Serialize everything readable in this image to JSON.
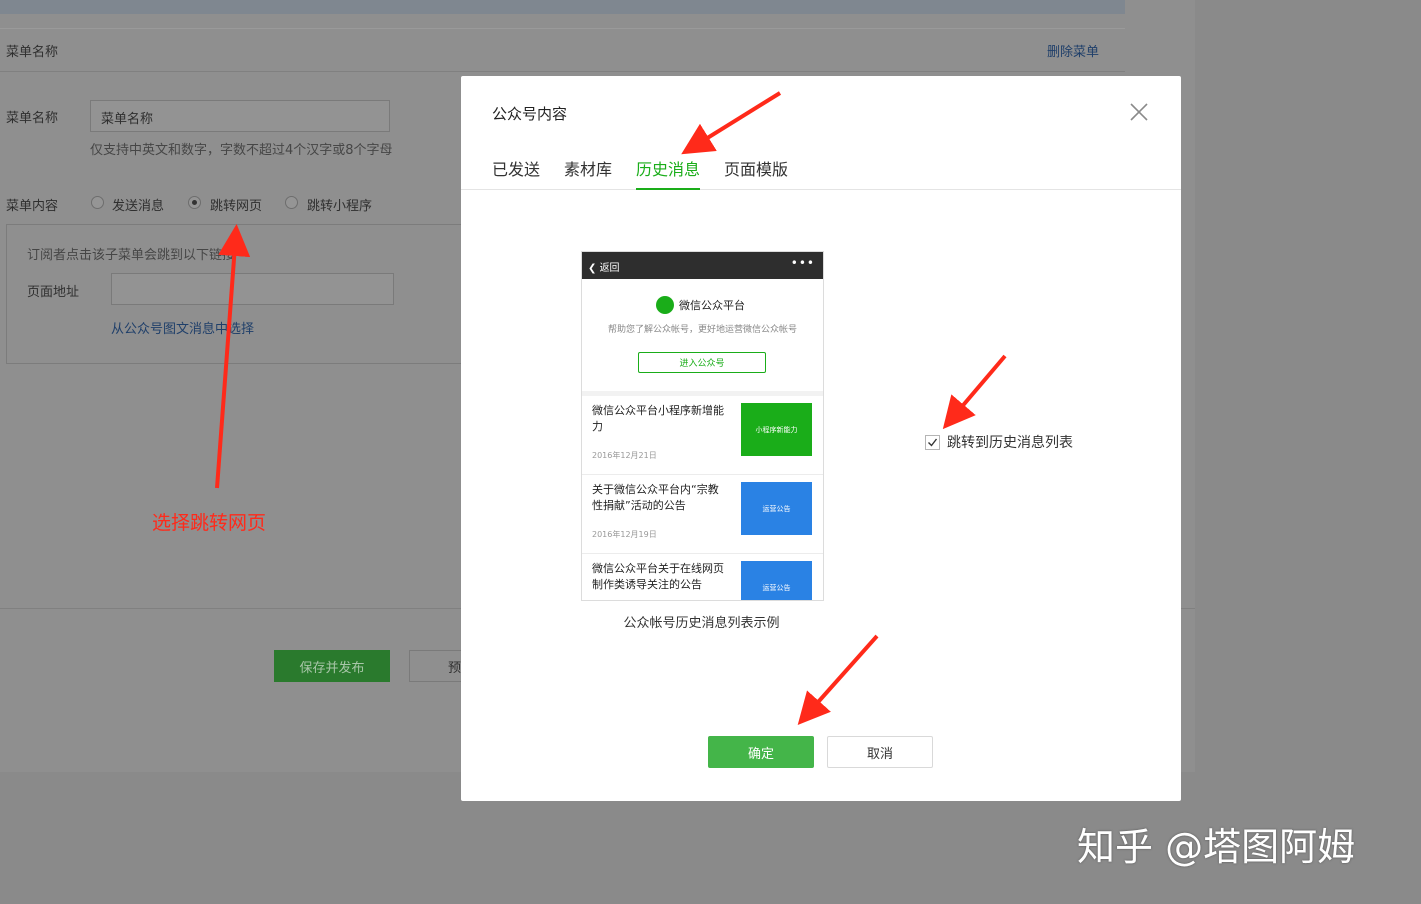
{
  "background": {
    "header_title": "菜单名称",
    "delete_menu": "删除菜单",
    "menu_name_label": "菜单名称",
    "menu_name_value": "菜单名称",
    "menu_name_hint": "仅支持中英文和数字，字数不超过4个汉字或8个字母",
    "menu_content_label": "菜单内容",
    "radio_options": [
      "发送消息",
      "跳转网页",
      "跳转小程序"
    ],
    "selected_radio": "跳转网页",
    "subscriber_hint": "订阅者点击该子菜单会跳到以下链接",
    "page_url_label": "页面地址",
    "page_url_value": "",
    "choose_from_articles": "从公众号图文消息中选择",
    "save_publish": "保存并发布",
    "preview": "预"
  },
  "annotation": {
    "text": "选择跳转网页",
    "color": "#ff2a1a"
  },
  "modal": {
    "title": "公众号内容",
    "tabs": [
      {
        "label": "已发送",
        "active": false
      },
      {
        "label": "素材库",
        "active": false
      },
      {
        "label": "历史消息",
        "active": true
      },
      {
        "label": "页面模版",
        "active": false
      }
    ],
    "phone": {
      "back": "返回",
      "more": "•••",
      "brand_name": "微信公众平台",
      "brand_desc": "帮助您了解公众帐号，更好地运营微信公众帐号",
      "enter_button": "进入公众号",
      "articles": [
        {
          "title": "微信公众平台小程序新增能力",
          "date": "2016年12月21日",
          "thumb_text": "小程序新能力",
          "thumb_color": "#1aad19"
        },
        {
          "title": "关于微信公众平台内“宗教性捐献”活动的公告",
          "date": "2016年12月19日",
          "thumb_text": "运营公告",
          "thumb_color": "#2a82e4"
        },
        {
          "title": "微信公众平台关于在线网页制作类诱导关注的公告",
          "date": "",
          "thumb_text": "运营公告",
          "thumb_color": "#2a82e4"
        }
      ]
    },
    "caption": "公众帐号历史消息列表示例",
    "checkbox_label": "跳转到历史消息列表",
    "checkbox_checked": true,
    "ok": "确定",
    "cancel": "取消"
  },
  "watermark": "知乎 @塔图阿姆",
  "colors": {
    "accent": "#1aad19",
    "ok_button": "#44b549",
    "arrow": "#ff2a1a"
  }
}
